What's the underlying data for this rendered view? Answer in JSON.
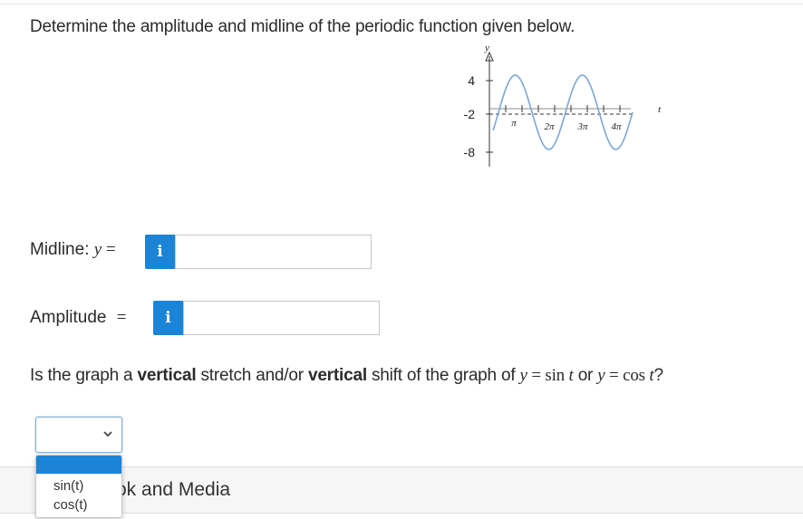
{
  "question": "Determine the amplitude and midline of the periodic function given below.",
  "graph": {
    "y_axis_label": "y",
    "x_axis_label": "t",
    "y_ticks": [
      "4",
      "-2",
      "-8"
    ],
    "x_ticks": [
      "π",
      "2π",
      "3π",
      "4π"
    ]
  },
  "midline": {
    "label": "Midline:",
    "math_var": "y",
    "math_eq": "=",
    "info_icon": "i",
    "value": ""
  },
  "amplitude": {
    "label": "Amplitude",
    "math_eq": "=",
    "info_icon": "i",
    "value": ""
  },
  "stretch_question": {
    "part1": "Is the graph a ",
    "bold1": "vertical",
    "part2": " stretch and/or ",
    "bold2": "vertical",
    "part3": " shift of the graph of ",
    "math1_var": "y",
    "math1_rest": " = sin ",
    "math1_t": "t",
    "or_text": " or ",
    "math2_var": "y",
    "math2_rest": " = cos ",
    "math2_t": "t",
    "end": "?"
  },
  "select": {
    "selected": "",
    "icon": "chevron-down-icon"
  },
  "dropdown_options": [
    "sin(t)",
    "cos(t)"
  ],
  "bottom_bar_text": "ok and Media",
  "colors": {
    "accent": "#1b84d6",
    "curve": "#7aa7d6"
  }
}
